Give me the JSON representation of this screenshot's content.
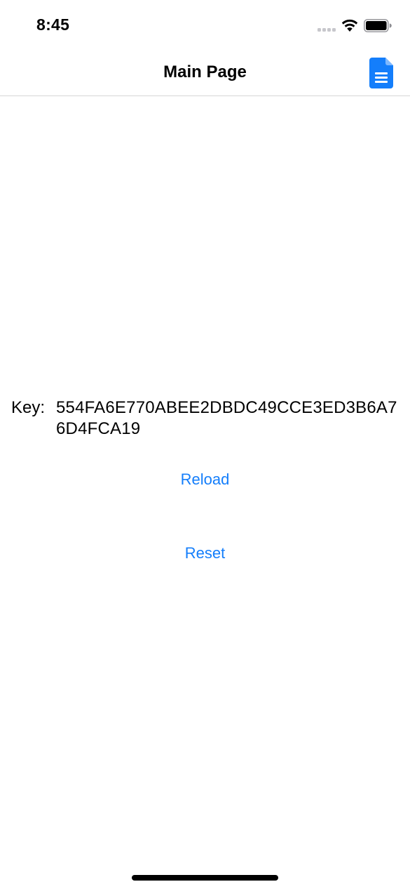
{
  "status_bar": {
    "time": "8:45",
    "signal_icon": "cellular-signal-icon",
    "wifi_icon": "wifi-icon",
    "battery_icon": "battery-icon"
  },
  "nav_bar": {
    "title": "Main Page",
    "right_button_icon": "document-icon",
    "accent_color": "#147efb"
  },
  "content": {
    "key_label": "Key:",
    "key_value": "554FA6E770ABEE2DBDC49CCE3ED3B6A76D4FCA19",
    "reload_label": "Reload",
    "reset_label": "Reset"
  }
}
